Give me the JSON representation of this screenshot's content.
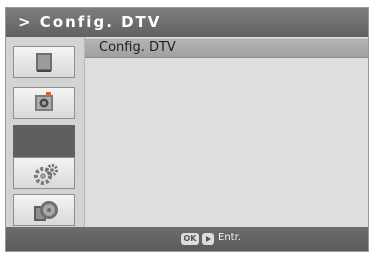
{
  "header": {
    "title": "> Config. DTV"
  },
  "sidebar": {
    "items": [
      {
        "icon": "tv-screen-icon"
      },
      {
        "icon": "speaker-icon"
      },
      {
        "icon": "selected-empty-slot"
      },
      {
        "icon": "gear-icon"
      },
      {
        "icon": "cards-disc-icon"
      }
    ]
  },
  "menu": {
    "items": [
      {
        "label": "Config. DTV"
      }
    ]
  },
  "footer": {
    "ok_label": "OK",
    "enter_label": "Entr."
  },
  "colors": {
    "title_bar": "#6e6e6e",
    "selected_row": "#a8a8a8",
    "sidebar_selected": "#5f5f5f"
  }
}
